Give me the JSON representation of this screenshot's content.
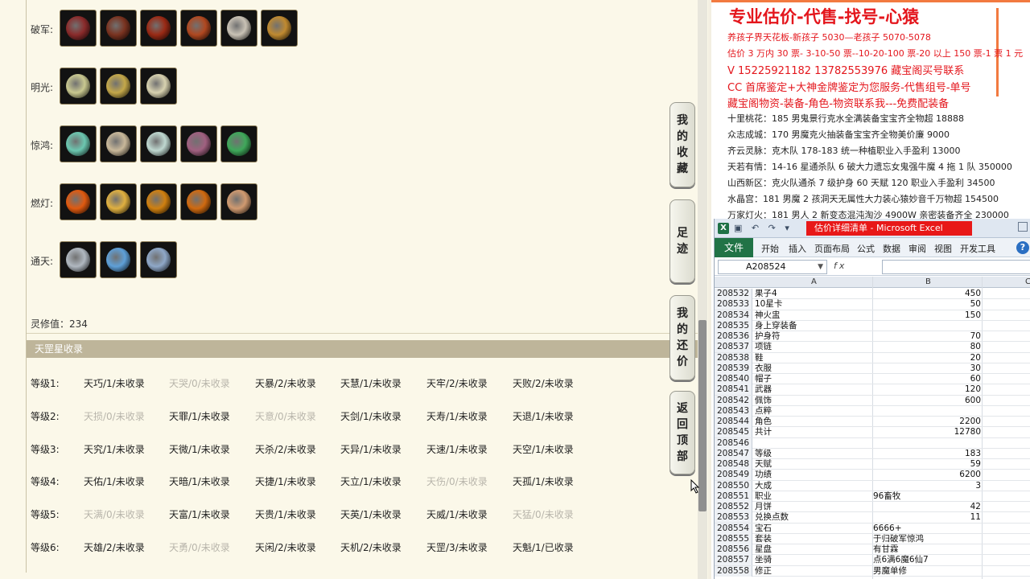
{
  "pets": [
    {
      "label": "破军:",
      "slots": [
        {
          "color": "#8a2b2b"
        },
        {
          "color": "#7a3320"
        },
        {
          "color": "#9a2a15"
        },
        {
          "color": "#b04820"
        },
        {
          "color": "#c9c2b5"
        },
        {
          "color": "#c08a30"
        }
      ]
    },
    {
      "label": "明光:",
      "slots": [
        {
          "color": "#c9c890"
        },
        {
          "color": "#c4a84a"
        },
        {
          "color": "#d8d2b0"
        }
      ]
    },
    {
      "label": "惊鸿:",
      "slots": [
        {
          "color": "#6cc7b0"
        },
        {
          "color": "#c9b89a"
        },
        {
          "color": "#bfd8d0"
        },
        {
          "color": "#a06080"
        },
        {
          "color": "#3fa85a"
        }
      ]
    },
    {
      "label": "燃灯:",
      "slots": [
        {
          "color": "#e05a10"
        },
        {
          "color": "#e0b040"
        },
        {
          "color": "#d08010"
        },
        {
          "color": "#d06a10"
        },
        {
          "color": "#d09a70"
        }
      ]
    },
    {
      "label": "通天:",
      "slots": [
        {
          "color": "#b0b8c0"
        },
        {
          "color": "#5fa0d8"
        },
        {
          "color": "#8fa8c8"
        }
      ]
    }
  ],
  "lingxiu": "灵修值：234",
  "collection": {
    "title": "天罡星收录",
    "rows": [
      {
        "level": "等级1:",
        "items": [
          {
            "t": "天巧/1/未收录",
            "dim": false
          },
          {
            "t": "天哭/0/未收录",
            "dim": true
          },
          {
            "t": "天暴/2/未收录",
            "dim": false
          },
          {
            "t": "天慧/1/未收录",
            "dim": false
          },
          {
            "t": "天牢/2/未收录",
            "dim": false
          },
          {
            "t": "天败/2/未收录",
            "dim": false
          }
        ]
      },
      {
        "level": "等级2:",
        "items": [
          {
            "t": "天损/0/未收录",
            "dim": true
          },
          {
            "t": "天罪/1/未收录",
            "dim": false
          },
          {
            "t": "天意/0/未收录",
            "dim": true
          },
          {
            "t": "天剑/1/未收录",
            "dim": false
          },
          {
            "t": "天寿/1/未收录",
            "dim": false
          },
          {
            "t": "天退/1/未收录",
            "dim": false
          }
        ]
      },
      {
        "level": "等级3:",
        "items": [
          {
            "t": "天究/1/未收录",
            "dim": false
          },
          {
            "t": "天微/1/未收录",
            "dim": false
          },
          {
            "t": "天杀/2/未收录",
            "dim": false
          },
          {
            "t": "天异/1/未收录",
            "dim": false
          },
          {
            "t": "天速/1/未收录",
            "dim": false
          },
          {
            "t": "天空/1/未收录",
            "dim": false
          }
        ]
      },
      {
        "level": "等级4:",
        "items": [
          {
            "t": "天佑/1/未收录",
            "dim": false
          },
          {
            "t": "天暗/1/未收录",
            "dim": false
          },
          {
            "t": "天捷/1/未收录",
            "dim": false
          },
          {
            "t": "天立/1/未收录",
            "dim": false
          },
          {
            "t": "天伤/0/未收录",
            "dim": true
          },
          {
            "t": "天孤/1/未收录",
            "dim": false
          }
        ]
      },
      {
        "level": "等级5:",
        "items": [
          {
            "t": "天满/0/未收录",
            "dim": true
          },
          {
            "t": "天富/1/未收录",
            "dim": false
          },
          {
            "t": "天贵/1/未收录",
            "dim": false
          },
          {
            "t": "天英/1/未收录",
            "dim": false
          },
          {
            "t": "天威/1/未收录",
            "dim": false
          },
          {
            "t": "天猛/0/未收录",
            "dim": true
          }
        ]
      },
      {
        "level": "等级6:",
        "items": [
          {
            "t": "天雄/2/未收录",
            "dim": false
          },
          {
            "t": "天勇/0/未收录",
            "dim": true
          },
          {
            "t": "天闲/2/未收录",
            "dim": false
          },
          {
            "t": "天机/2/未收录",
            "dim": false
          },
          {
            "t": "天罡/3/未收录",
            "dim": false
          },
          {
            "t": "天魁/1/已收录",
            "dim": false
          }
        ]
      }
    ]
  },
  "side_buttons": [
    {
      "label": "我的收藏",
      "chars": [
        "我",
        "的",
        "收",
        "藏"
      ]
    },
    {
      "label": "足迹",
      "chars": [
        "足",
        "迹"
      ]
    },
    {
      "label": "我的还价",
      "chars": [
        "我",
        "的",
        "还",
        "价"
      ]
    },
    {
      "label": "返回顶部",
      "chars": [
        "返",
        "回",
        "顶",
        "部"
      ]
    }
  ],
  "doc": {
    "title": "专业估价-代售-找号-心猿",
    "red_lines": [
      {
        "text": "养孩子界天花板-新孩子 5030—老孩子 5070-5078",
        "big": false
      },
      {
        "text": "估价 3 万内 30 票- 3-10-50 票--10-20-100 票-20 以上 150 票-1 票 1 元",
        "big": false
      },
      {
        "text": "V 15225921182       13782553976     藏宝阁买号联系",
        "big": true
      },
      {
        "text": "CC 首席鉴定+大神金牌鉴定为您服务-代售组号-单号",
        "big": true
      },
      {
        "text": "藏宝阁物资-装备-角色-物资联系我---免费配装备",
        "big": true
      }
    ],
    "black_lines": [
      "十里桃花：185 男鬼景行克水全满装备宝宝齐全物超 18888",
      "众志成城：170 男魔克火抽装备宝宝齐全物美价廉 9000",
      "齐云灵脉：克木队 178-183 统一种植职业入手盈利 13000",
      "天若有情：14-16 星通杀队 6 破大力遗忘女鬼强牛魔 4 拖 1 队 350000",
      "山西新区：克火队通杀 7 级护身 60 天赋 120 职业入手盈利 34500",
      "水晶宫：181 男魔 2 孩洞天无属性大力装心猿妙音千万物超 154500",
      "万家灯火：181 男人 2 新变态混沌淘沙 4900W 亲密装备齐全 230000"
    ]
  },
  "excel": {
    "title": "估价详细清单 - Microsoft Excel",
    "qat": "▣ ↶ ↷ ▾",
    "file_tab": "文件",
    "tabs": [
      "开始",
      "插入",
      "页面布局",
      "公式",
      "数据",
      "审阅",
      "视图",
      "开发工具"
    ],
    "name_box": "A208524",
    "fx": "fx",
    "col_a": "A",
    "col_b": "B",
    "col_c": "C",
    "rows": [
      {
        "n": "208532",
        "a": "果子4",
        "b": "450",
        "num": true
      },
      {
        "n": "208533",
        "a": "10星卡",
        "b": "50",
        "num": true
      },
      {
        "n": "208534",
        "a": "神火盅",
        "b": "150",
        "num": true
      },
      {
        "n": "208535",
        "a": "身上穿装备",
        "b": "",
        "num": true
      },
      {
        "n": "208536",
        "a": "护身符",
        "b": "70",
        "num": true
      },
      {
        "n": "208537",
        "a": "项链",
        "b": "80",
        "num": true
      },
      {
        "n": "208538",
        "a": "鞋",
        "b": "20",
        "num": true
      },
      {
        "n": "208539",
        "a": "衣服",
        "b": "30",
        "num": true
      },
      {
        "n": "208540",
        "a": "帽子",
        "b": "60",
        "num": true
      },
      {
        "n": "208541",
        "a": "武器",
        "b": "120",
        "num": true
      },
      {
        "n": "208542",
        "a": "佩饰",
        "b": "600",
        "num": true
      },
      {
        "n": "208543",
        "a": "点粹",
        "b": "",
        "num": true
      },
      {
        "n": "208544",
        "a": "角色",
        "b": "2200",
        "num": true
      },
      {
        "n": "208545",
        "a": "共计",
        "b": "12780",
        "num": true
      },
      {
        "n": "208546",
        "a": "",
        "b": "",
        "num": true
      },
      {
        "n": "208547",
        "a": "等级",
        "b": "183",
        "num": true
      },
      {
        "n": "208548",
        "a": "天赋",
        "b": "59",
        "num": true
      },
      {
        "n": "208549",
        "a": "功绩",
        "b": "6200",
        "num": true
      },
      {
        "n": "208550",
        "a": "大成",
        "b": "3",
        "num": true
      },
      {
        "n": "208551",
        "a": "职业",
        "b": "96畜牧",
        "num": false
      },
      {
        "n": "208552",
        "a": "月饼",
        "b": "42",
        "num": true
      },
      {
        "n": "208553",
        "a": "兑换点数",
        "b": "11",
        "num": true
      },
      {
        "n": "208554",
        "a": "宝石",
        "b": "6666+",
        "num": false
      },
      {
        "n": "208555",
        "a": "套装",
        "b": "于归破军惊鸿",
        "num": false
      },
      {
        "n": "208556",
        "a": "星盘",
        "b": "有甘霖",
        "num": false
      },
      {
        "n": "208557",
        "a": "坐骑",
        "b": "点6满6魔6仙7",
        "num": false
      },
      {
        "n": "208558",
        "a": "修正",
        "b": "男魔单修",
        "num": false
      }
    ]
  }
}
